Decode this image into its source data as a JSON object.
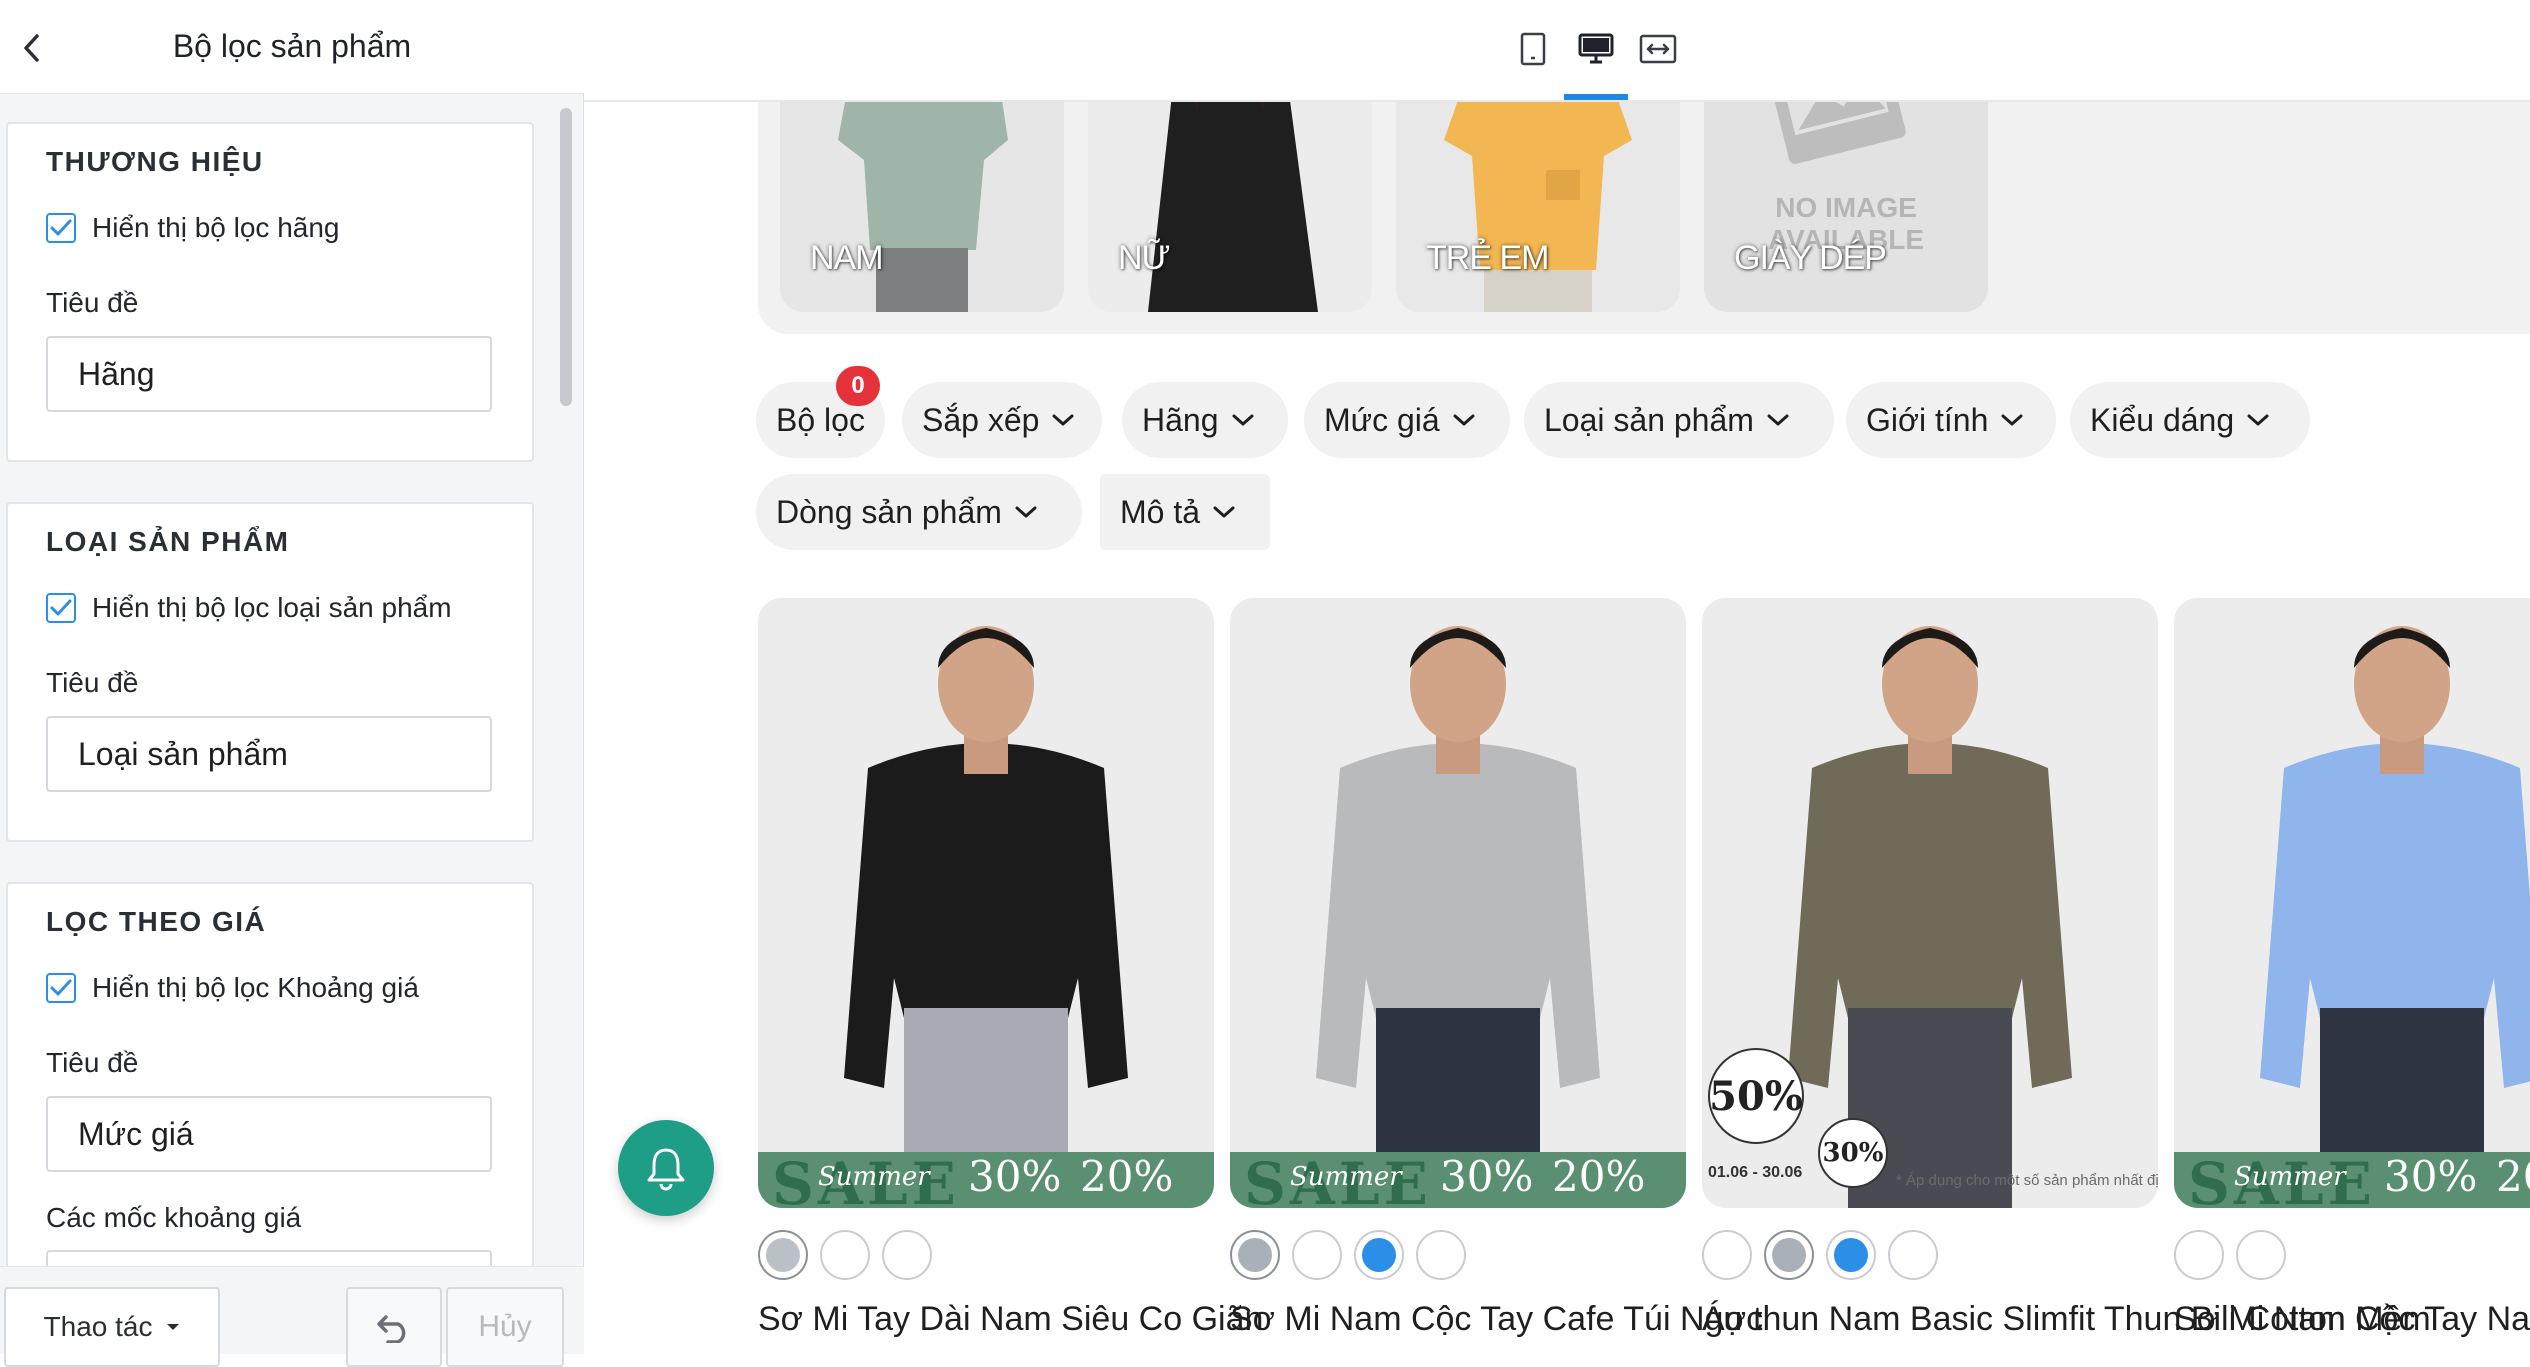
{
  "panel": {
    "title": "Bộ lọc sản phẩm",
    "sections": [
      {
        "title": "THƯƠNG HIỆU",
        "checkbox_label": "Hiển thị bộ lọc hãng",
        "checked": true,
        "field_label": "Tiêu đề",
        "field_value": "Hãng"
      },
      {
        "title": "LOẠI SẢN PHẨM",
        "checkbox_label": "Hiển thị bộ lọc loại sản phẩm",
        "checked": true,
        "field_label": "Tiêu đề",
        "field_value": "Loại sản phẩm"
      },
      {
        "title": "LỌC THEO GIÁ",
        "checkbox_label": "Hiển thị bộ lọc Khoảng giá",
        "checked": true,
        "field_label": "Tiêu đề",
        "field_value": "Mức giá",
        "extra_label": "Các mốc khoảng giá"
      }
    ],
    "footer": {
      "actions_label": "Thao tác",
      "cancel_label": "Hủy"
    }
  },
  "preview": {
    "categories": [
      {
        "label": "NAM"
      },
      {
        "label": "NỮ"
      },
      {
        "label": "TRẺ EM"
      },
      {
        "label": "GIÀY DÉP",
        "placeholder_text": "NO IMAGE AVAILABLE"
      }
    ],
    "filter_badge": "0",
    "filters": [
      {
        "label": "Bộ lọc",
        "dropdown": false
      },
      {
        "label": "Sắp xếp",
        "dropdown": true
      },
      {
        "label": "Hãng",
        "dropdown": true
      },
      {
        "label": "Mức giá",
        "dropdown": true
      },
      {
        "label": "Loại sản phẩm",
        "dropdown": true
      },
      {
        "label": "Giới tính",
        "dropdown": true
      },
      {
        "label": "Kiểu dáng",
        "dropdown": true
      },
      {
        "label": "Dòng sản phẩm",
        "dropdown": true
      },
      {
        "label": "Mô tả",
        "dropdown": true
      }
    ],
    "banner": {
      "sale": "SALE",
      "summer": "Summer",
      "pct_1": "30%",
      "pct_2": "20%"
    },
    "products": [
      {
        "name": "Sơ Mi Tay Dài Nam Siêu Co Giãn",
        "swatches": [
          "#b9c0c6",
          "#ffffff",
          "#ffffff"
        ],
        "selected_swatch": 0,
        "shirt": "#1b1b1b",
        "pants": "#a9a9b3",
        "banner": true
      },
      {
        "name": "Sơ Mi Nam Cộc Tay Cafe Túi Ngực",
        "swatches": [
          "#a9b0b7",
          "#ffffff",
          "#2b8fe8",
          "#ffffff"
        ],
        "selected_swatch": 0,
        "shirt": "#b9babc",
        "pants": "#2c3441",
        "banner": true
      },
      {
        "name": "Áo thun Nam Basic Slimfit Thun Bili Cotton Mềm",
        "swatches": [
          "#ffffff",
          "#a9b0b7",
          "#2b8fe8",
          "#ffffff"
        ],
        "selected_swatch": 1,
        "shirt": "#6f6b58",
        "pants": "#4a4b52",
        "banner": false,
        "promo_50": "50%",
        "promo_30": "30%",
        "promo_note": "* Áp dụng cho một số sản phẩm nhất định",
        "promo_date": "01.06 - 30.06"
      },
      {
        "name": "Sơ Mi Nam Cộc Tay Nano Co Giãn",
        "swatches": [
          "#ffffff",
          "#ffffff"
        ],
        "selected_swatch": -1,
        "shirt": "#8fb5ec",
        "pants": "#2e3442",
        "banner": true
      }
    ]
  },
  "colors": {
    "accent": "#1e88e5",
    "checkbox": "#2d8ee8",
    "badge": "#e5323a",
    "bell": "#1e9e86",
    "banner": "#5a9071"
  }
}
